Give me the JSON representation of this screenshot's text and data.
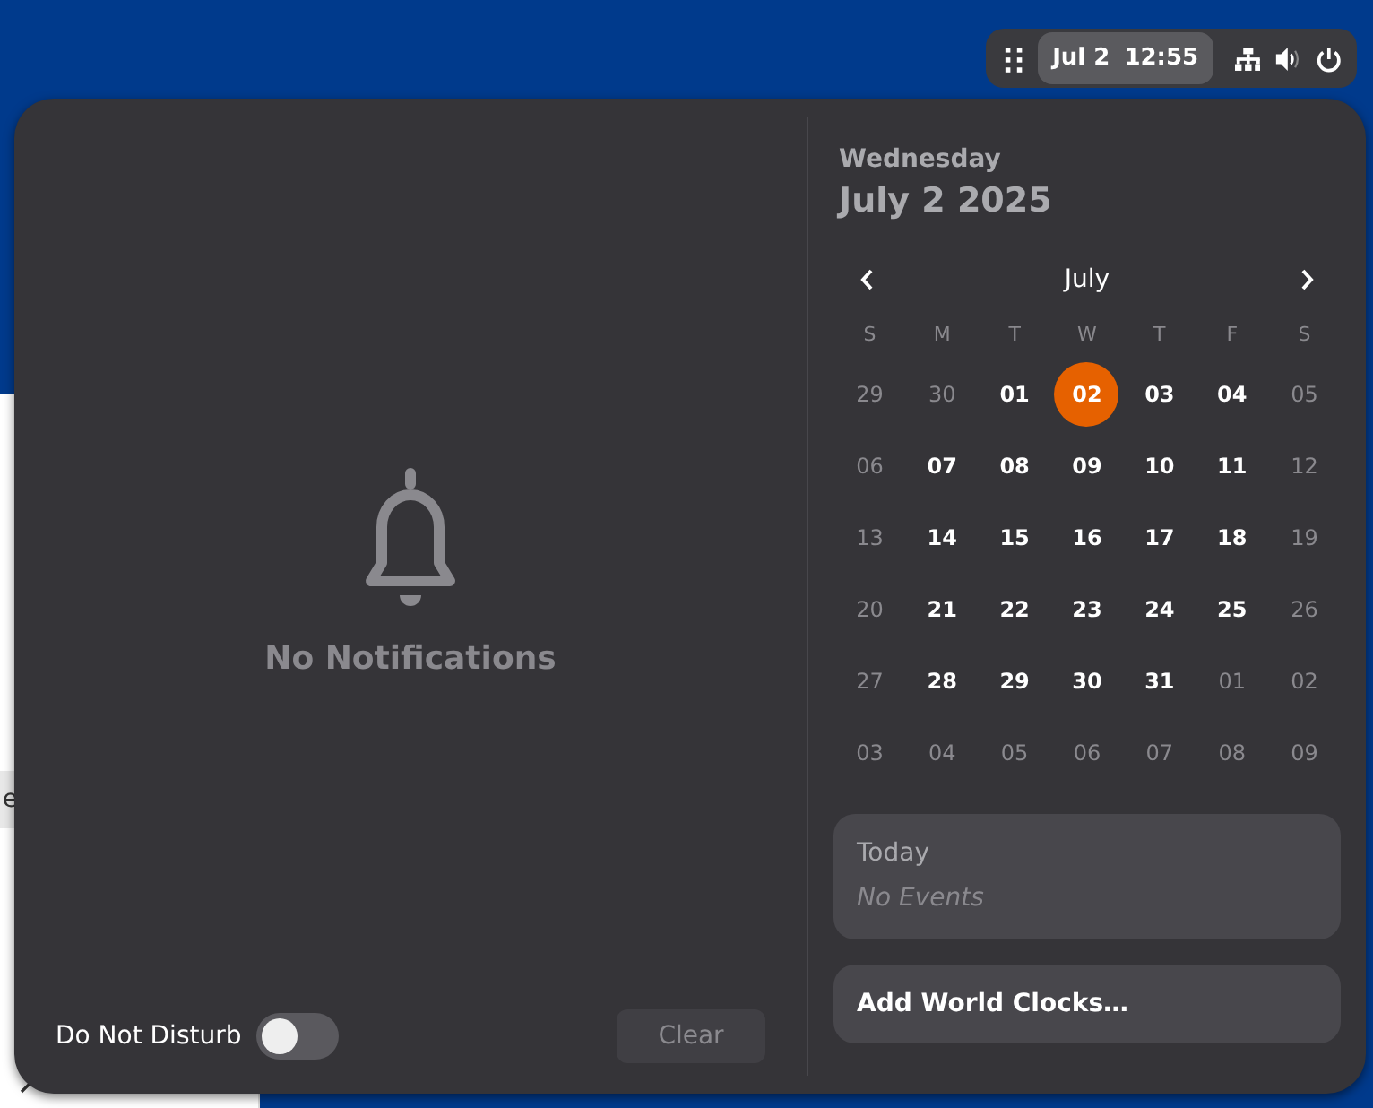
{
  "background_window": {
    "tab_label": "e"
  },
  "top_bar": {
    "clock": {
      "date": "Jul 2",
      "time": "12:55",
      "selected": true
    }
  },
  "notifications": {
    "empty_text": "No Notifications",
    "do_not_disturb": {
      "label": "Do Not Disturb",
      "on": false
    },
    "clear_button": {
      "label": "Clear",
      "disabled": true
    }
  },
  "date_header": {
    "weekday": "Wednesday",
    "date": "July 2 2025"
  },
  "calendar": {
    "month": "July",
    "weekdays": [
      "S",
      "M",
      "T",
      "W",
      "T",
      "F",
      "S"
    ],
    "weeks": [
      [
        {
          "label": "29",
          "dim": true,
          "selected": false
        },
        {
          "label": "30",
          "dim": true,
          "selected": false
        },
        {
          "label": "01",
          "dim": false,
          "selected": false
        },
        {
          "label": "02",
          "dim": false,
          "selected": true
        },
        {
          "label": "03",
          "dim": false,
          "selected": false
        },
        {
          "label": "04",
          "dim": false,
          "selected": false
        },
        {
          "label": "05",
          "dim": true,
          "selected": false
        }
      ],
      [
        {
          "label": "06",
          "dim": true,
          "selected": false
        },
        {
          "label": "07",
          "dim": false,
          "selected": false
        },
        {
          "label": "08",
          "dim": false,
          "selected": false
        },
        {
          "label": "09",
          "dim": false,
          "selected": false
        },
        {
          "label": "10",
          "dim": false,
          "selected": false
        },
        {
          "label": "11",
          "dim": false,
          "selected": false
        },
        {
          "label": "12",
          "dim": true,
          "selected": false
        }
      ],
      [
        {
          "label": "13",
          "dim": true,
          "selected": false
        },
        {
          "label": "14",
          "dim": false,
          "selected": false
        },
        {
          "label": "15",
          "dim": false,
          "selected": false
        },
        {
          "label": "16",
          "dim": false,
          "selected": false
        },
        {
          "label": "17",
          "dim": false,
          "selected": false
        },
        {
          "label": "18",
          "dim": false,
          "selected": false
        },
        {
          "label": "19",
          "dim": true,
          "selected": false
        }
      ],
      [
        {
          "label": "20",
          "dim": true,
          "selected": false
        },
        {
          "label": "21",
          "dim": false,
          "selected": false
        },
        {
          "label": "22",
          "dim": false,
          "selected": false
        },
        {
          "label": "23",
          "dim": false,
          "selected": false
        },
        {
          "label": "24",
          "dim": false,
          "selected": false
        },
        {
          "label": "25",
          "dim": false,
          "selected": false
        },
        {
          "label": "26",
          "dim": true,
          "selected": false
        }
      ],
      [
        {
          "label": "27",
          "dim": true,
          "selected": false
        },
        {
          "label": "28",
          "dim": false,
          "selected": false
        },
        {
          "label": "29",
          "dim": false,
          "selected": false
        },
        {
          "label": "30",
          "dim": false,
          "selected": false
        },
        {
          "label": "31",
          "dim": false,
          "selected": false
        },
        {
          "label": "01",
          "dim": true,
          "selected": false
        },
        {
          "label": "02",
          "dim": true,
          "selected": false
        }
      ],
      [
        {
          "label": "03",
          "dim": true,
          "selected": false
        },
        {
          "label": "04",
          "dim": true,
          "selected": false
        },
        {
          "label": "05",
          "dim": true,
          "selected": false
        },
        {
          "label": "06",
          "dim": true,
          "selected": false
        },
        {
          "label": "07",
          "dim": true,
          "selected": false
        },
        {
          "label": "08",
          "dim": true,
          "selected": false
        },
        {
          "label": "09",
          "dim": true,
          "selected": false
        }
      ]
    ]
  },
  "events": {
    "title": "Today",
    "empty_text": "No Events"
  },
  "world_clocks": {
    "label": "Add World Clocks…"
  }
}
